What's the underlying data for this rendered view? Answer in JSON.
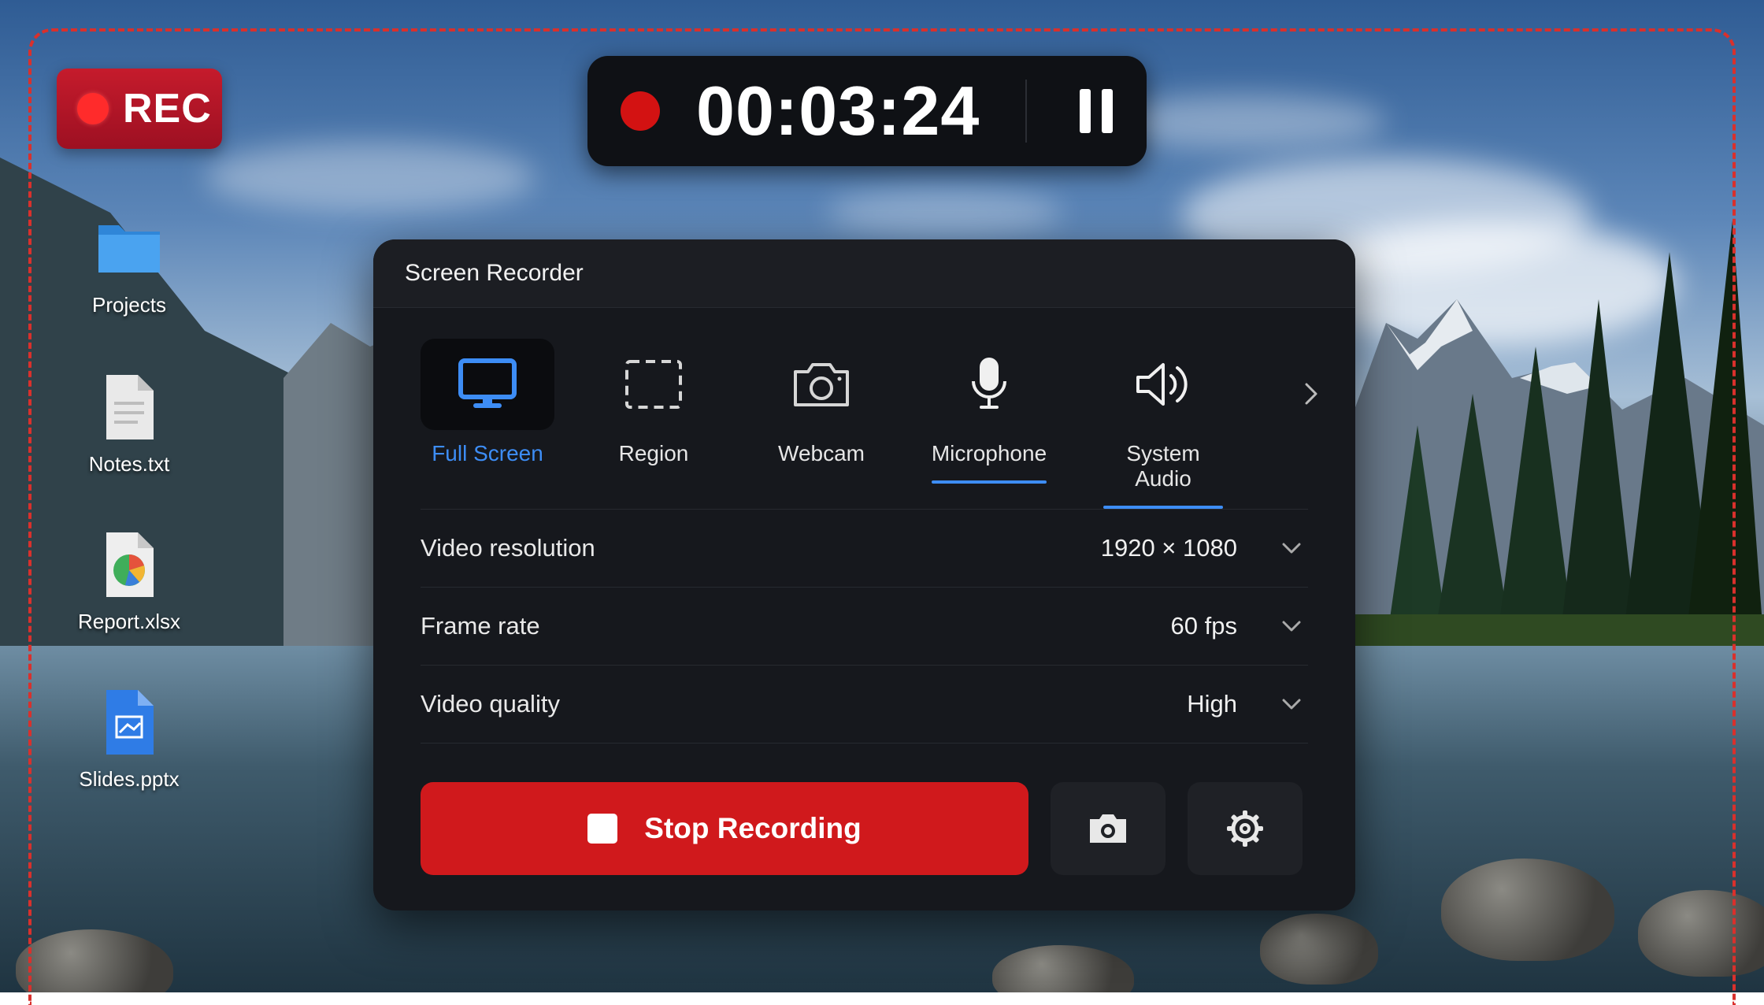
{
  "recording_badge": {
    "label": "REC"
  },
  "timer": {
    "elapsed": "00:03:24",
    "pause_icon": "pause-icon"
  },
  "desktop_icons": [
    {
      "label": "Projects",
      "icon": "folder-icon"
    },
    {
      "label": "Notes.txt",
      "icon": "text-file-icon"
    },
    {
      "label": "Report.xlsx",
      "icon": "spreadsheet-file-icon"
    },
    {
      "label": "Slides.pptx",
      "icon": "presentation-file-icon"
    }
  ],
  "panel": {
    "title": "Screen Recorder",
    "modes": [
      {
        "label": "Full Screen",
        "icon": "monitor-icon",
        "selected": true
      },
      {
        "label": "Region",
        "icon": "region-select-icon",
        "selected": false
      },
      {
        "label": "Webcam",
        "icon": "camera-icon",
        "selected": false
      },
      {
        "label": "Microphone",
        "icon": "microphone-icon",
        "selected": false,
        "enabled": true
      },
      {
        "label": "System Audio",
        "icon": "speaker-icon",
        "selected": false,
        "enabled": true
      }
    ],
    "settings": [
      {
        "label": "Video resolution",
        "value": "1920 × 1080"
      },
      {
        "label": "Frame rate",
        "value": "60 fps"
      },
      {
        "label": "Video quality",
        "value": "High"
      }
    ],
    "stop_button": {
      "label": "Stop Recording"
    },
    "screenshot_button_icon": "camera-icon",
    "settings_button_icon": "gear-icon"
  },
  "colors": {
    "accent": "#3d8df5",
    "record_red": "#d0191c",
    "panel_bg": "#16181d",
    "frame_dash": "#d9302c"
  }
}
